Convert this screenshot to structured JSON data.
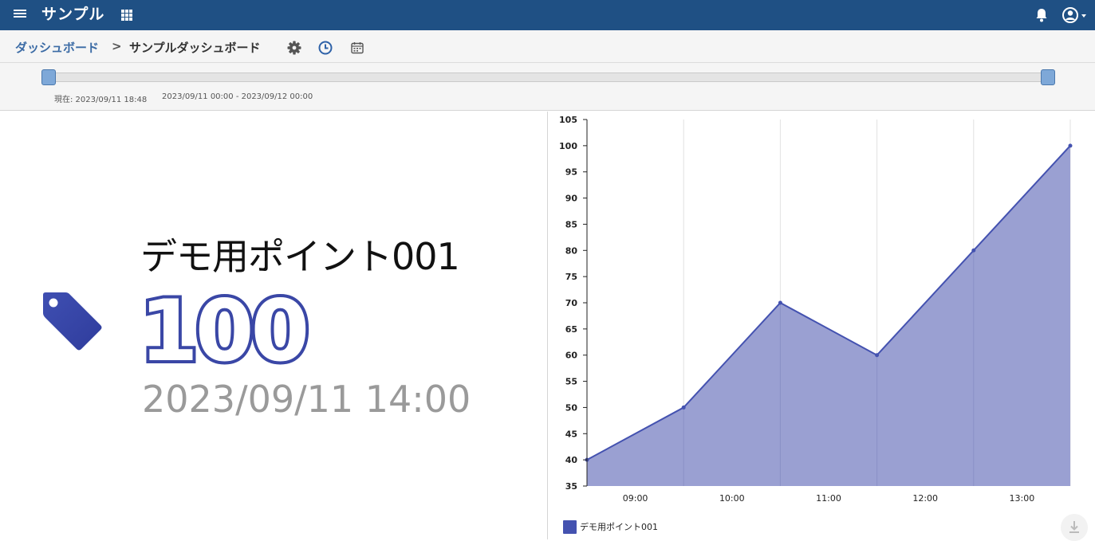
{
  "header": {
    "app_title": "サンプル",
    "menu_icon": "hamburger-menu-icon",
    "apps_icon": "apps-grid-icon",
    "notification_icon": "bell-icon",
    "account_icon": "account-circle-icon",
    "brand_color": "#1f5084"
  },
  "breadcrumb": {
    "root": "ダッシュボード",
    "separator": ">",
    "current": "サンプルダッシュボード",
    "tools": [
      "gear-icon",
      "clock-icon",
      "calendar-icon"
    ]
  },
  "time_range": {
    "now_label": "現在: 2023/09/11 18:48",
    "range_label": "2023/09/11 00:00 - 2023/09/12 00:00"
  },
  "panel": {
    "icon": "tag-icon",
    "point_name": "デモ用ポイント001",
    "value": "100",
    "timestamp": "2023/09/11 14:00",
    "accent_color": "#3a47a6"
  },
  "chart_data": {
    "type": "area",
    "x": [
      "08:30",
      "09:30",
      "10:30",
      "11:30",
      "12:30",
      "13:30"
    ],
    "x_tick_labels": [
      "09:00",
      "10:00",
      "11:00",
      "12:00",
      "13:00"
    ],
    "series": [
      {
        "name": "デモ用ポイント001",
        "values": [
          40,
          50,
          70,
          60,
          80,
          100
        ],
        "color": "#4452b0",
        "fill": "#9aa0d2"
      }
    ],
    "ylim": [
      35,
      105
    ],
    "y_ticks": [
      35,
      40,
      45,
      50,
      55,
      60,
      65,
      70,
      75,
      80,
      85,
      90,
      95,
      100,
      105
    ],
    "grid": "vertical",
    "legend": "bottom-left",
    "download_icon": "download-icon"
  }
}
